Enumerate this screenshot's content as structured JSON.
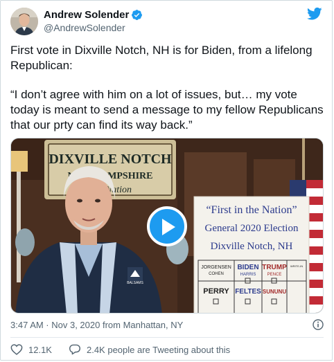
{
  "author": {
    "display_name": "Andrew Solender",
    "handle": "@AndrewSolender"
  },
  "tweet": {
    "paragraph_1": "First vote in Dixville Notch, NH is for Biden, from a lifelong Republican:",
    "paragraph_2": "“I don’t agree with him on a lot of issues, but… my vote today is meant to send a message to my fellow Republicans that our prty can find its way back.”"
  },
  "video": {
    "sign_top": [
      "DIXVILLE NOTCH",
      "NEW HAMPSHIRE",
      "Nation"
    ],
    "board_title": [
      "“First in the Nation”",
      "General 2020 Election",
      "Dixville Notch, NH"
    ],
    "board_candidates": [
      "JORGENSEN",
      "COHEN",
      "BIDEN",
      "HARRIS",
      "TRUMP",
      "PENCE",
      "WRITE-IN",
      "PERRY",
      "FELTES",
      "SUNUNU"
    ],
    "shirt_logo": "BALSAMS"
  },
  "meta": {
    "timestamp": "3:47 AM · Nov 3, 2020 from Manhattan, NY"
  },
  "actions": {
    "likes": "12.1K",
    "tweeting_about": "2.4K people are Tweeting about this"
  },
  "colors": {
    "accent": "#1d9bf0",
    "text": "#0f1419",
    "secondary": "#536471"
  }
}
